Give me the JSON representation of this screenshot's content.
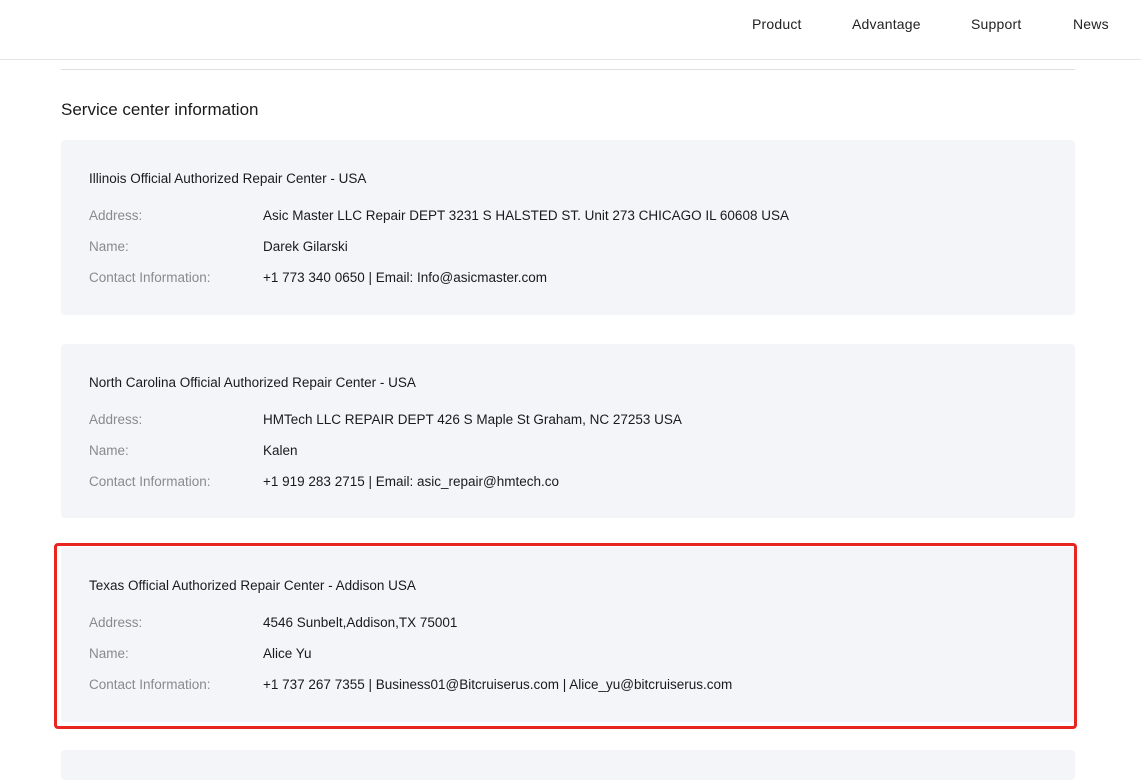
{
  "nav": {
    "items": [
      {
        "label": "Product"
      },
      {
        "label": "Advantage"
      },
      {
        "label": "Support"
      },
      {
        "label": "News"
      }
    ]
  },
  "section": {
    "title": "Service center information"
  },
  "centers": [
    {
      "title": "Illinois Official Authorized Repair Center - USA",
      "address_label": "Address:",
      "address": "Asic Master LLC Repair DEPT 3231 S HALSTED ST. Unit 273 CHICAGO IL 60608 USA",
      "name_label": "Name:",
      "name": "Darek Gilarski",
      "contact_label": "Contact Information:",
      "contact": "+1 773 340 0650 | Email: Info@asicmaster.com"
    },
    {
      "title": "North Carolina Official Authorized Repair Center - USA",
      "address_label": "Address:",
      "address": "HMTech LLC REPAIR DEPT 426 S Maple St Graham, NC 27253 USA",
      "name_label": "Name:",
      "name": "Kalen",
      "contact_label": "Contact Information:",
      "contact": "+1 919 283 2715 | Email: asic_repair@hmtech.co"
    },
    {
      "title": "Texas Official Authorized Repair Center - Addison USA",
      "address_label": "Address:",
      "address": "4546 Sunbelt,Addison,TX 75001",
      "name_label": "Name:",
      "name": "Alice Yu",
      "contact_label": "Contact Information:",
      "contact": "+1 737 267 7355 | Business01@Bitcruiserus.com | Alice_yu@bitcruiserus.com"
    }
  ],
  "colors": {
    "card_background": "#f4f5f9",
    "highlight_border": "#e8251f",
    "label_text": "#8a8a8a"
  }
}
